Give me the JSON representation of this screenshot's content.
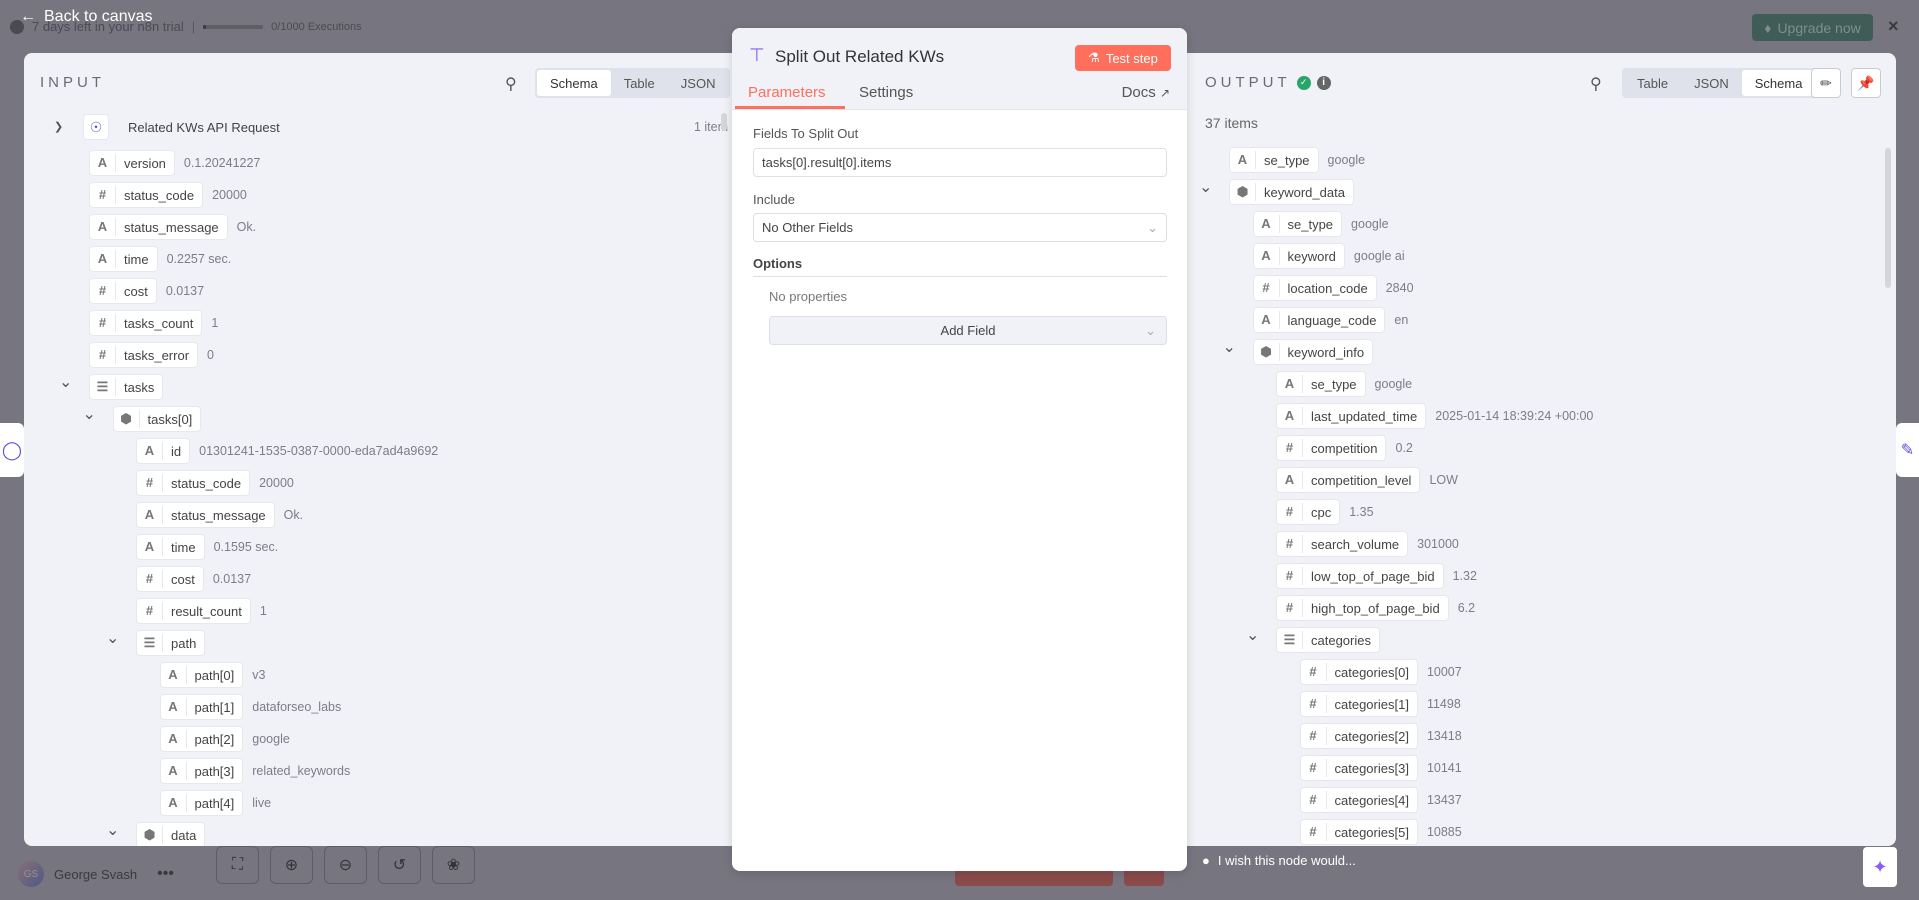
{
  "topbar": {
    "back_label": "Back to canvas",
    "trial_text": "7 days left in your n8n trial",
    "executions": "0/1000 Executions",
    "upgrade_label": "Upgrade now",
    "executions_progress": 0.0
  },
  "input": {
    "label": "INPUT",
    "tabs": [
      "Schema",
      "Table",
      "JSON"
    ],
    "active_tab": "Schema",
    "source_node": "Related KWs API Request",
    "item_count": "1 item",
    "tree": [
      {
        "d": 1,
        "t": "string",
        "k": "version",
        "v": "0.1.20241227"
      },
      {
        "d": 1,
        "t": "number",
        "k": "status_code",
        "v": "20000"
      },
      {
        "d": 1,
        "t": "string",
        "k": "status_message",
        "v": "Ok."
      },
      {
        "d": 1,
        "t": "string",
        "k": "time",
        "v": "0.2257 sec."
      },
      {
        "d": 1,
        "t": "number",
        "k": "cost",
        "v": "0.0137"
      },
      {
        "d": 1,
        "t": "number",
        "k": "tasks_count",
        "v": "1"
      },
      {
        "d": 1,
        "t": "number",
        "k": "tasks_error",
        "v": "0"
      },
      {
        "d": 1,
        "t": "array",
        "k": "tasks",
        "v": "",
        "open": true
      },
      {
        "d": 2,
        "t": "object",
        "k": "tasks[0]",
        "v": "",
        "open": true
      },
      {
        "d": 3,
        "t": "string",
        "k": "id",
        "v": "01301241-1535-0387-0000-eda7ad4a9692"
      },
      {
        "d": 3,
        "t": "number",
        "k": "status_code",
        "v": "20000"
      },
      {
        "d": 3,
        "t": "string",
        "k": "status_message",
        "v": "Ok."
      },
      {
        "d": 3,
        "t": "string",
        "k": "time",
        "v": "0.1595 sec."
      },
      {
        "d": 3,
        "t": "number",
        "k": "cost",
        "v": "0.0137"
      },
      {
        "d": 3,
        "t": "number",
        "k": "result_count",
        "v": "1"
      },
      {
        "d": 3,
        "t": "array",
        "k": "path",
        "v": "",
        "open": true
      },
      {
        "d": 4,
        "t": "string",
        "k": "path[0]",
        "v": "v3"
      },
      {
        "d": 4,
        "t": "string",
        "k": "path[1]",
        "v": "dataforseo_labs"
      },
      {
        "d": 4,
        "t": "string",
        "k": "path[2]",
        "v": "google"
      },
      {
        "d": 4,
        "t": "string",
        "k": "path[3]",
        "v": "related_keywords"
      },
      {
        "d": 4,
        "t": "string",
        "k": "path[4]",
        "v": "live"
      },
      {
        "d": 3,
        "t": "object",
        "k": "data",
        "v": "",
        "open": true
      }
    ]
  },
  "node": {
    "title": "Split Out Related KWs",
    "test_label": "Test step",
    "tabs": [
      "Parameters",
      "Settings"
    ],
    "active_tab": "Parameters",
    "docs_label": "Docs",
    "fields_label": "Fields To Split Out",
    "fields_value": "tasks[0].result[0].items",
    "include_label": "Include",
    "include_value": "No Other Fields",
    "options_label": "Options",
    "no_props": "No properties",
    "add_field": "Add Field"
  },
  "output": {
    "label": "OUTPUT",
    "tabs": [
      "Table",
      "JSON",
      "Schema"
    ],
    "active_tab": "Schema",
    "item_count": "37 items",
    "status_color": "#29a568",
    "tree": [
      {
        "d": 1,
        "t": "string",
        "k": "se_type",
        "v": "google"
      },
      {
        "d": 1,
        "t": "object",
        "k": "keyword_data",
        "v": "",
        "open": true
      },
      {
        "d": 2,
        "t": "string",
        "k": "se_type",
        "v": "google"
      },
      {
        "d": 2,
        "t": "string",
        "k": "keyword",
        "v": "google ai"
      },
      {
        "d": 2,
        "t": "number",
        "k": "location_code",
        "v": "2840"
      },
      {
        "d": 2,
        "t": "string",
        "k": "language_code",
        "v": "en"
      },
      {
        "d": 2,
        "t": "object",
        "k": "keyword_info",
        "v": "",
        "open": true
      },
      {
        "d": 3,
        "t": "string",
        "k": "se_type",
        "v": "google"
      },
      {
        "d": 3,
        "t": "string",
        "k": "last_updated_time",
        "v": "2025-01-14 18:39:24 +00:00"
      },
      {
        "d": 3,
        "t": "number",
        "k": "competition",
        "v": "0.2"
      },
      {
        "d": 3,
        "t": "string",
        "k": "competition_level",
        "v": "LOW"
      },
      {
        "d": 3,
        "t": "number",
        "k": "cpc",
        "v": "1.35"
      },
      {
        "d": 3,
        "t": "number",
        "k": "search_volume",
        "v": "301000"
      },
      {
        "d": 3,
        "t": "number",
        "k": "low_top_of_page_bid",
        "v": "1.32"
      },
      {
        "d": 3,
        "t": "number",
        "k": "high_top_of_page_bid",
        "v": "6.2"
      },
      {
        "d": 3,
        "t": "array",
        "k": "categories",
        "v": "",
        "open": true
      },
      {
        "d": 4,
        "t": "number",
        "k": "categories[0]",
        "v": "10007"
      },
      {
        "d": 4,
        "t": "number",
        "k": "categories[1]",
        "v": "11498"
      },
      {
        "d": 4,
        "t": "number",
        "k": "categories[2]",
        "v": "13418"
      },
      {
        "d": 4,
        "t": "number",
        "k": "categories[3]",
        "v": "10141"
      },
      {
        "d": 4,
        "t": "number",
        "k": "categories[4]",
        "v": "13437"
      },
      {
        "d": 4,
        "t": "number",
        "k": "categories[5]",
        "v": "10885"
      }
    ]
  },
  "footer": {
    "wish_text": "I wish this node would...",
    "user_name": "George Svash",
    "user_initials": "GS"
  },
  "colors": {
    "accent": "#ff6f5c",
    "node_icon": "#8b5cf6"
  }
}
